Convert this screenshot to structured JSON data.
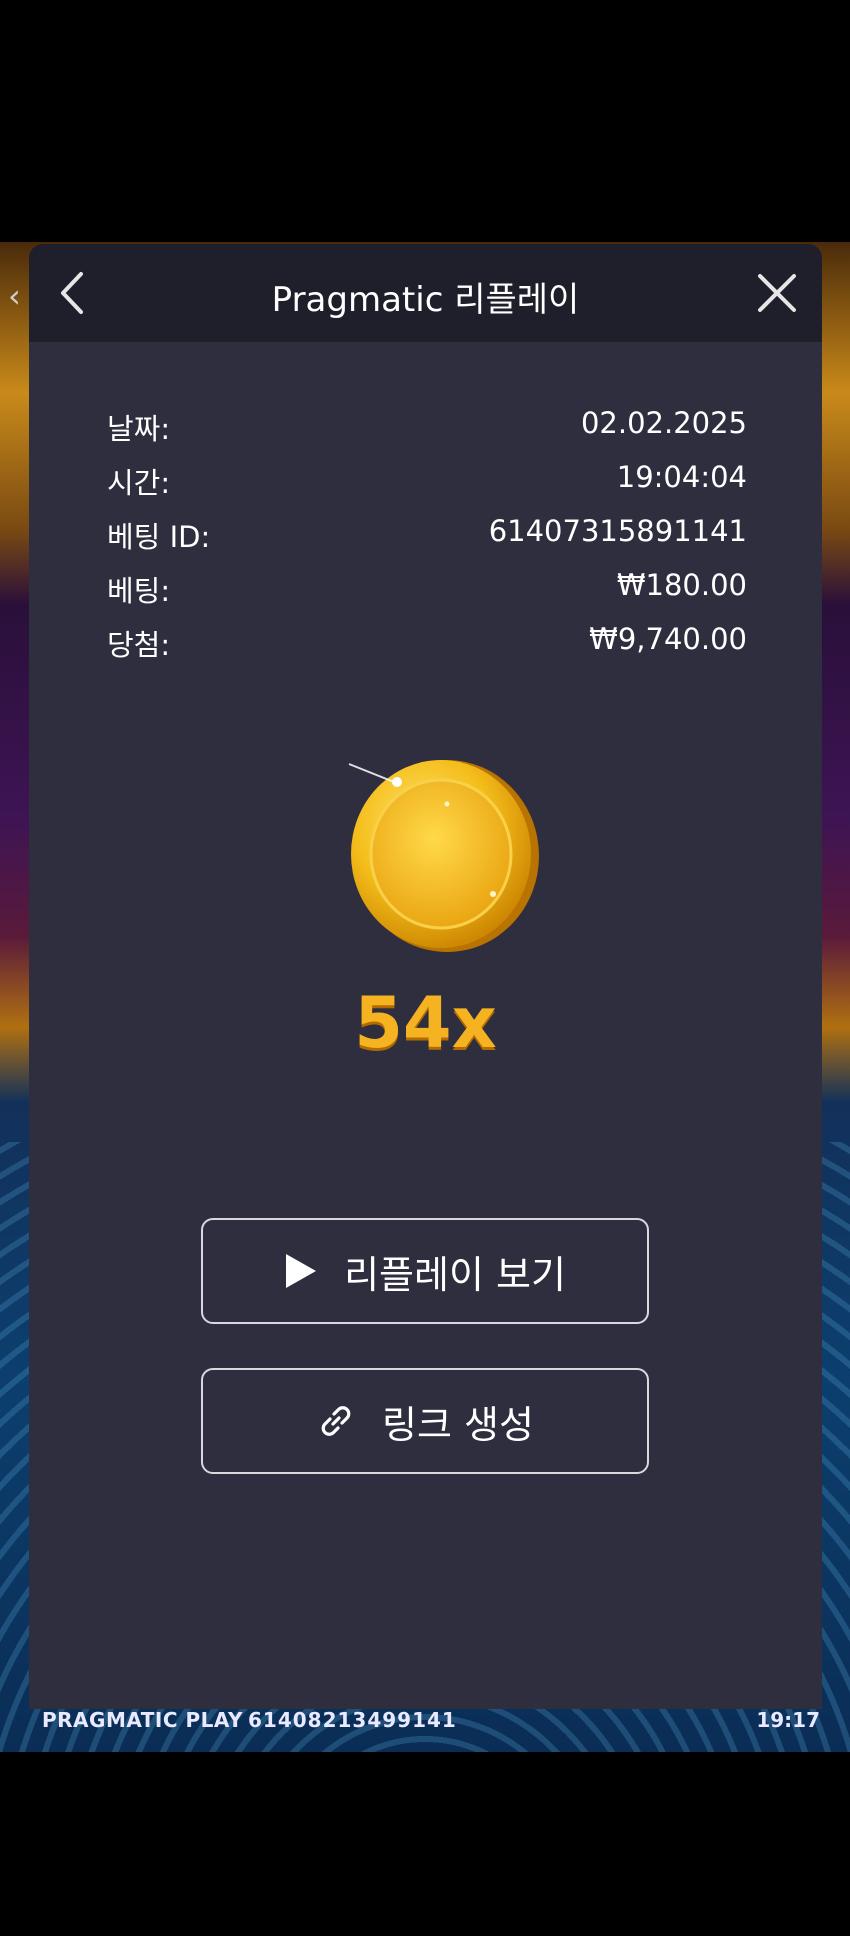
{
  "header": {
    "title": "Pragmatic 리플레이"
  },
  "details": [
    {
      "label": "날짜:",
      "value": "02.02.2025"
    },
    {
      "label": "시간:",
      "value": "19:04:04"
    },
    {
      "label": "베팅 ID:",
      "value": "61407315891141"
    },
    {
      "label": "베팅:",
      "value": "₩180.00"
    },
    {
      "label": "당첨:",
      "value": "₩9,740.00"
    }
  ],
  "result": {
    "multiplier": "54x"
  },
  "actions": {
    "replay_label": "리플레이 보기",
    "link_label": "링크 생성"
  },
  "game_footer": {
    "brand": "PRAGMATIC PLAY",
    "bet_id": "61408213499141",
    "clock": "19:17"
  },
  "colors": {
    "modal_bg": "#2e2e3f",
    "header_bg": "#1f1f2b",
    "multiplier": "#f5b321"
  }
}
